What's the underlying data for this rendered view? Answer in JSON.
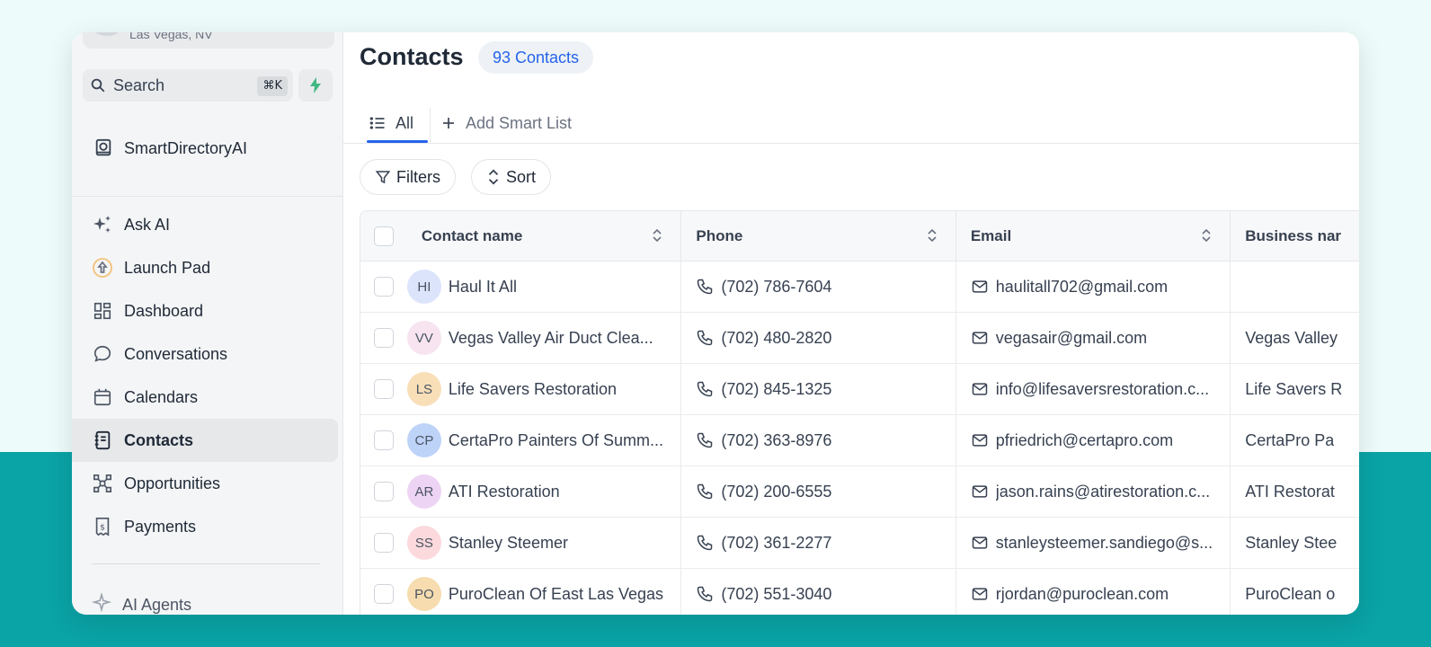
{
  "location": {
    "city": "Las Vegas, NV"
  },
  "search": {
    "label": "Search",
    "shortcut": "⌘K"
  },
  "brand": {
    "label": "SmartDirectoryAI"
  },
  "nav": [
    {
      "label": "Ask AI",
      "icon": "sparkles-icon"
    },
    {
      "label": "Launch Pad",
      "icon": "rocket-icon"
    },
    {
      "label": "Dashboard",
      "icon": "dashboard-icon"
    },
    {
      "label": "Conversations",
      "icon": "chat-icon"
    },
    {
      "label": "Calendars",
      "icon": "calendar-icon"
    },
    {
      "label": "Contacts",
      "icon": "contacts-icon",
      "active": true
    },
    {
      "label": "Opportunities",
      "icon": "opportunities-icon"
    },
    {
      "label": "Payments",
      "icon": "payments-icon"
    }
  ],
  "nav_bottom": {
    "label": "AI Agents"
  },
  "header": {
    "title": "Contacts",
    "count_badge": "93 Contacts"
  },
  "tabs": {
    "all": "All",
    "add_smart_list": "Add Smart List"
  },
  "toolbar": {
    "filters": "Filters",
    "sort": "Sort"
  },
  "table": {
    "columns": [
      "Contact name",
      "Phone",
      "Email",
      "Business nar"
    ],
    "rows": [
      {
        "initials": "HI",
        "avatar_color": "#dbe4fb",
        "name": "Haul It All",
        "phone": "(702) 786-7604",
        "email": "haulitall702@gmail.com",
        "business": ""
      },
      {
        "initials": "VV",
        "avatar_color": "#f7e4f0",
        "name": "Vegas Valley Air Duct Clea...",
        "phone": "(702) 480-2820",
        "email": "vegasair@gmail.com",
        "business": "Vegas Valley"
      },
      {
        "initials": "LS",
        "avatar_color": "#f8dfb8",
        "name": "Life Savers Restoration",
        "phone": "(702) 845-1325",
        "email": "info@lifesaversrestoration.c...",
        "business": "Life Savers R"
      },
      {
        "initials": "CP",
        "avatar_color": "#bed3f8",
        "name": "CertaPro Painters Of Summ...",
        "phone": "(702) 363-8976",
        "email": "pfriedrich@certapro.com",
        "business": "CertaPro Pa"
      },
      {
        "initials": "AR",
        "avatar_color": "#eed4f4",
        "name": "ATI Restoration",
        "phone": "(702) 200-6555",
        "email": "jason.rains@atirestoration.c...",
        "business": "ATI Restorat"
      },
      {
        "initials": "SS",
        "avatar_color": "#fbd9dd",
        "name": "Stanley Steemer",
        "phone": "(702) 361-2277",
        "email": "stanleysteemer.sandiego@s...",
        "business": "Stanley Stee"
      },
      {
        "initials": "PO",
        "avatar_color": "#f6dcae",
        "name": "PuroClean Of East Las Vegas",
        "phone": "(702) 551-3040",
        "email": "rjordan@puroclean.com",
        "business": "PuroClean o"
      }
    ]
  },
  "colors": {
    "accent": "#2563eb",
    "teal_bg": "#0aa3a6",
    "bolt": "#3fb87f"
  }
}
